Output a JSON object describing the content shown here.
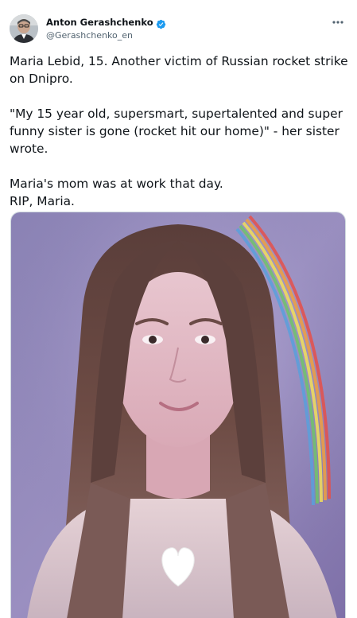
{
  "author": {
    "display_name": "Anton Gerashchenko",
    "handle": "@Gerashchenko_en",
    "verified": true
  },
  "icons": {
    "verified": "verified-badge-icon",
    "more": "more-options-icon",
    "heart": "white-heart-emoji-icon"
  },
  "tweet": {
    "paragraph_1": "Maria Lebid, 15. Another victim of Russian rocket strike on Dnipro.",
    "paragraph_2": "\"My 15 year old, supersmart, supertalented and super funny sister is gone (rocket hit our home)\" - her sister wrote.",
    "paragraph_3_line_1": "Maria's mom was at work that day.",
    "paragraph_3_line_2": "RIP, Maria."
  },
  "colors": {
    "verified_blue": "#1d9bf0",
    "text_primary": "#0f1419",
    "text_secondary": "#536471",
    "photo_background_purple": "#8c7fb2"
  }
}
